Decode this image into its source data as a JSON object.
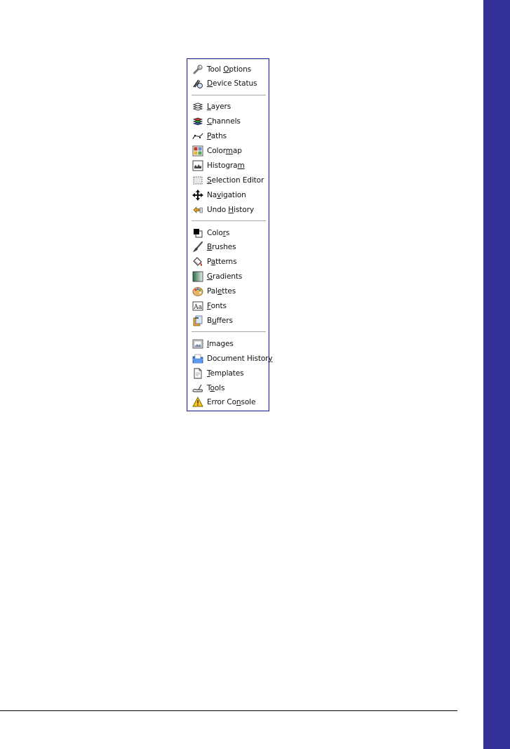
{
  "menu": {
    "groups": [
      {
        "items": [
          {
            "label": "Tool Options",
            "mnemonic": "O",
            "icon": "wrench-icon"
          },
          {
            "label": "Device Status",
            "mnemonic": "D",
            "icon": "device-status-icon"
          }
        ]
      },
      {
        "items": [
          {
            "label": "Layers",
            "mnemonic": "L",
            "icon": "layers-icon"
          },
          {
            "label": "Channels",
            "mnemonic": "C",
            "icon": "channels-icon"
          },
          {
            "label": "Paths",
            "mnemonic": "P",
            "icon": "paths-icon"
          },
          {
            "label": "Colormap",
            "mnemonic": "m",
            "icon": "colormap-icon"
          },
          {
            "label": "Histogram",
            "mnemonic": "m",
            "icon": "histogram-icon"
          },
          {
            "label": "Selection Editor",
            "mnemonic": "S",
            "icon": "selection-editor-icon"
          },
          {
            "label": "Navigation",
            "mnemonic": "v",
            "icon": "navigation-icon"
          },
          {
            "label": "Undo History",
            "mnemonic": "H",
            "icon": "undo-history-icon"
          }
        ]
      },
      {
        "items": [
          {
            "label": "Colors",
            "mnemonic": "r",
            "icon": "colors-icon"
          },
          {
            "label": "Brushes",
            "mnemonic": "B",
            "icon": "brushes-icon"
          },
          {
            "label": "Patterns",
            "mnemonic": "a",
            "icon": "patterns-icon"
          },
          {
            "label": "Gradients",
            "mnemonic": "G",
            "icon": "gradients-icon"
          },
          {
            "label": "Palettes",
            "mnemonic": "e",
            "icon": "palettes-icon"
          },
          {
            "label": "Fonts",
            "mnemonic": "F",
            "icon": "fonts-icon"
          },
          {
            "label": "Buffers",
            "mnemonic": "u",
            "icon": "buffers-icon"
          }
        ]
      },
      {
        "items": [
          {
            "label": "Images",
            "mnemonic": "I",
            "icon": "images-icon"
          },
          {
            "label": "Document History",
            "mnemonic": "y",
            "icon": "document-history-icon"
          },
          {
            "label": "Templates",
            "mnemonic": "T",
            "icon": "templates-icon"
          },
          {
            "label": "Tools",
            "mnemonic": "o",
            "icon": "tools-icon"
          },
          {
            "label": "Error Console",
            "mnemonic": "n",
            "icon": "warning-icon"
          }
        ]
      }
    ]
  },
  "colors": {
    "side_band": "#33309a",
    "menu_border": "#2b2f8f",
    "separator": "#a8a8a8"
  }
}
